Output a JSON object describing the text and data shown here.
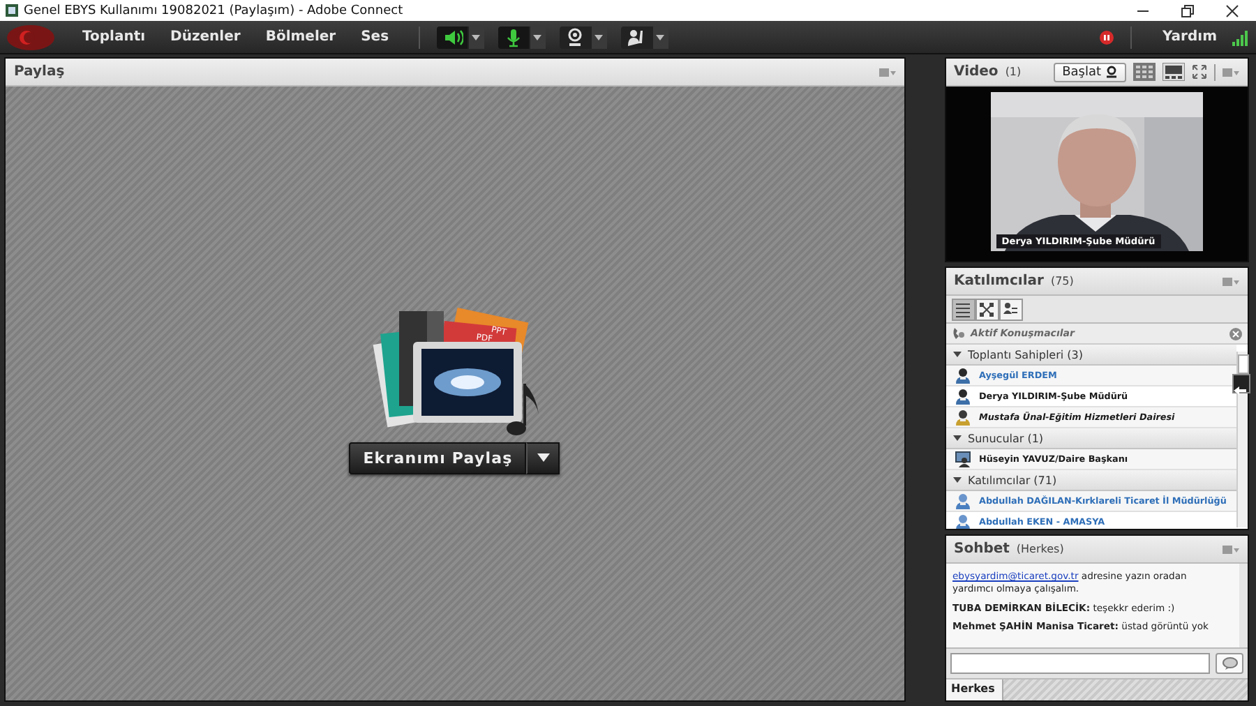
{
  "window": {
    "title": "Genel EBYS Kullanımı  19082021 (Paylaşım) - Adobe Connect"
  },
  "menu": {
    "items": [
      "Toplantı",
      "Düzenler",
      "Bölmeler",
      "Ses"
    ],
    "tools": [
      {
        "kind": "speaker",
        "on": true
      },
      {
        "kind": "mic",
        "on": true
      },
      {
        "kind": "camera",
        "on": false
      },
      {
        "kind": "hand",
        "on": false
      }
    ],
    "help": "Yardım"
  },
  "share": {
    "title": "Paylaş",
    "button": "Ekranımı Paylaş",
    "doc_labels": [
      "PPT",
      "PDF"
    ]
  },
  "video": {
    "title": "Video",
    "count": "(1)",
    "start_button": "Başlat",
    "caption": "Derya YILDIRIM-Şube Müdürü"
  },
  "attendees": {
    "title": "Katılımcılar",
    "count": "(75)",
    "active_speakers": "Aktif Konuşmacılar",
    "groups": [
      {
        "label": "Toplantı Sahipleri (3)",
        "expanded": true,
        "children": [
          {
            "name": "Ayşegül ERDEM",
            "kind": "host",
            "color": "#2f6fb8",
            "italic": false
          },
          {
            "name": "Derya YILDIRIM-Şube Müdürü",
            "kind": "host",
            "color": "#1a1a1a",
            "italic": false
          },
          {
            "name": "Mustafa Ünal-Eğitim Hizmetleri Dairesi",
            "kind": "host-away",
            "color": "#1a1a1a",
            "italic": true
          }
        ]
      },
      {
        "label": "Sunucular (1)",
        "expanded": true,
        "children": [
          {
            "name": "Hüseyin YAVUZ/Daire Başkanı",
            "kind": "presenter",
            "color": "#1a1a1a",
            "italic": false
          }
        ]
      },
      {
        "label": "Katılımcılar (71)",
        "expanded": true,
        "children": [
          {
            "name": "Abdullah DAĞILAN-Kırklareli Ticaret İl Müdürlüğü",
            "kind": "participant",
            "color": "#2f6fb8",
            "italic": false
          },
          {
            "name": "Abdullah EKEN - AMASYA",
            "kind": "participant",
            "color": "#2f6fb8",
            "italic": false
          }
        ]
      }
    ]
  },
  "chat": {
    "title": "Sohbet",
    "scope": "(Herkes)",
    "messages": [
      {
        "link": "ebysyardim@ticaret.gov.tr",
        "text": " adresine yazın oradan yardımcı olmaya  çalışalım."
      },
      {
        "text": "**TUBA DEMİRKAN BİLECİK:** teşekkr ederim :)"
      },
      {
        "text": "**Mehmet ŞAHİN Manisa Ticaret:** üstad görüntü yok"
      }
    ],
    "tab": "Herkes"
  }
}
